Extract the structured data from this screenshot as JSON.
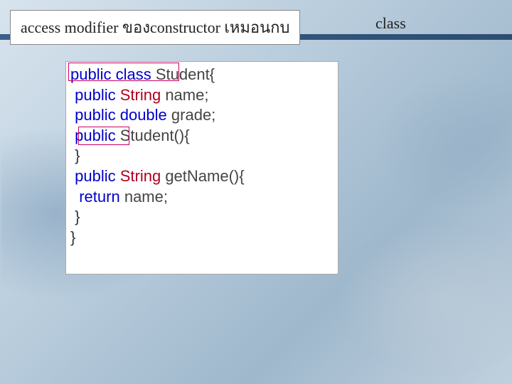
{
  "title": "access modifier ของconstructor เหมอนกบ",
  "class_label": "class",
  "code": {
    "l1": {
      "kw": "public",
      "kw2": "class",
      "ident": " Student{",
      "indent": ""
    },
    "l2": {
      "kw": "public",
      "type": " String",
      "ident": " name;",
      "indent": " "
    },
    "l3": {
      "kw": "public",
      "type": " double",
      "ident": " grade;",
      "indent": " "
    },
    "l4": {
      "kw": "public",
      "ident": " Student(){",
      "indent": " "
    },
    "l5": {
      "text": " }",
      "indent": ""
    },
    "l6": {
      "kw": "public",
      "type": " String",
      "ident": " getName(){",
      "indent": " "
    },
    "l7": {
      "kw": "return",
      "ident": " name;",
      "indent": "  "
    },
    "l8": {
      "text": " }",
      "indent": ""
    },
    "l9": {
      "text": "}",
      "indent": ""
    }
  }
}
